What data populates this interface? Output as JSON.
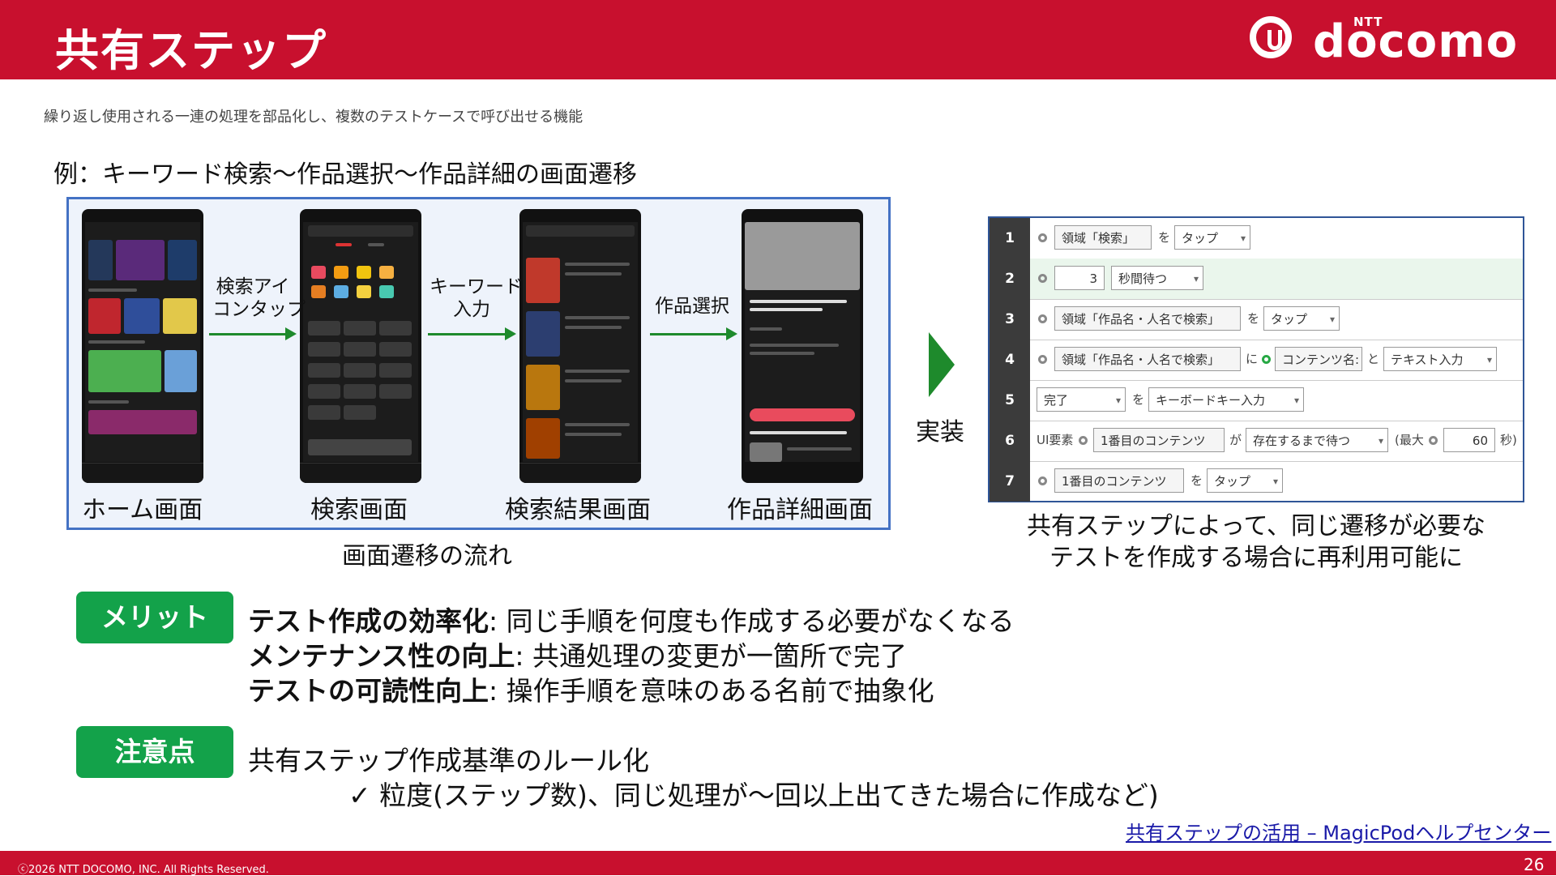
{
  "header": {
    "title": "共有ステップ",
    "logo": {
      "ntt": "NTT",
      "wordmark": "docomo"
    }
  },
  "subtitle": "繰り返し使用される一連の処理を部品化し、複数のテストケースで呼び出せる機能",
  "example_title": "例：キーワード検索～作品選択～作品詳細の画面遷移",
  "flow": {
    "screens": [
      "ホーム画面",
      "検索画面",
      "検索結果画面",
      "作品詳細画面"
    ],
    "arrow_labels": [
      [
        "検索アイ",
        "コンタップ"
      ],
      [
        "キーワード",
        "入力"
      ],
      [
        "作品選択"
      ]
    ],
    "caption": "画面遷移の流れ"
  },
  "implement_label": "実装",
  "steps": [
    {
      "num": "1"
    },
    {
      "num": "2"
    },
    {
      "num": "3"
    },
    {
      "num": "4"
    },
    {
      "num": "5"
    },
    {
      "num": "6"
    },
    {
      "num": "7"
    }
  ],
  "step_text": {
    "r1": {
      "target": "領域「検索」",
      "particle": "を",
      "action": "タップ"
    },
    "r2": {
      "value": "3",
      "action": "秒間待つ"
    },
    "r3": {
      "target": "領域「作品名・人名で検索」",
      "particle": "を",
      "action": "タップ"
    },
    "r4": {
      "target": "領域「作品名・人名で検索」",
      "particle": "に",
      "input": "コンテンツ名:",
      "particle2": "と",
      "action": "テキスト入力"
    },
    "r5": {
      "key": "完了",
      "particle": "を",
      "action": "キーボードキー入力"
    },
    "r6": {
      "prefix": "UI要素",
      "target": "1番目のコンテンツ",
      "particle": "が",
      "action": "存在するまで待つ",
      "max_label": "(最大",
      "max_value": "60",
      "unit": "秒)"
    },
    "r7": {
      "target": "1番目のコンテンツ",
      "particle": "を",
      "action": "タップ"
    }
  },
  "steps_caption": [
    "共有ステップによって、同じ遷移が必要な",
    "テストを作成する場合に再利用可能に"
  ],
  "merit": {
    "badge": "メリット",
    "items": [
      {
        "bold": "テスト作成の効率化",
        "text": ": 同じ手順を何度も作成する必要がなくなる"
      },
      {
        "bold": "メンテナンス性の向上",
        "text": ": 共通処理の変更が一箇所で完了"
      },
      {
        "bold": "テストの可読性向上",
        "text": ": 操作手順を意味のある名前で抽象化"
      }
    ]
  },
  "caution": {
    "badge": "注意点",
    "line": "共有ステップ作成基準のルール化",
    "sub": "✓ 粒度(ステップ数)、同じ処理が～回以上出てきた場合に作成など)"
  },
  "help_link": "共有ステップの活用 – MagicPodヘルプセンター",
  "footer": {
    "copyright": "ⓒ2026 NTT DOCOMO, INC. All Rights Reserved.",
    "page": "26"
  },
  "colors": {
    "brand_red": "#c8102e",
    "badge_green": "#13a24a",
    "arrow_green": "#1e8a2c",
    "frame_blue": "#4472c4"
  }
}
